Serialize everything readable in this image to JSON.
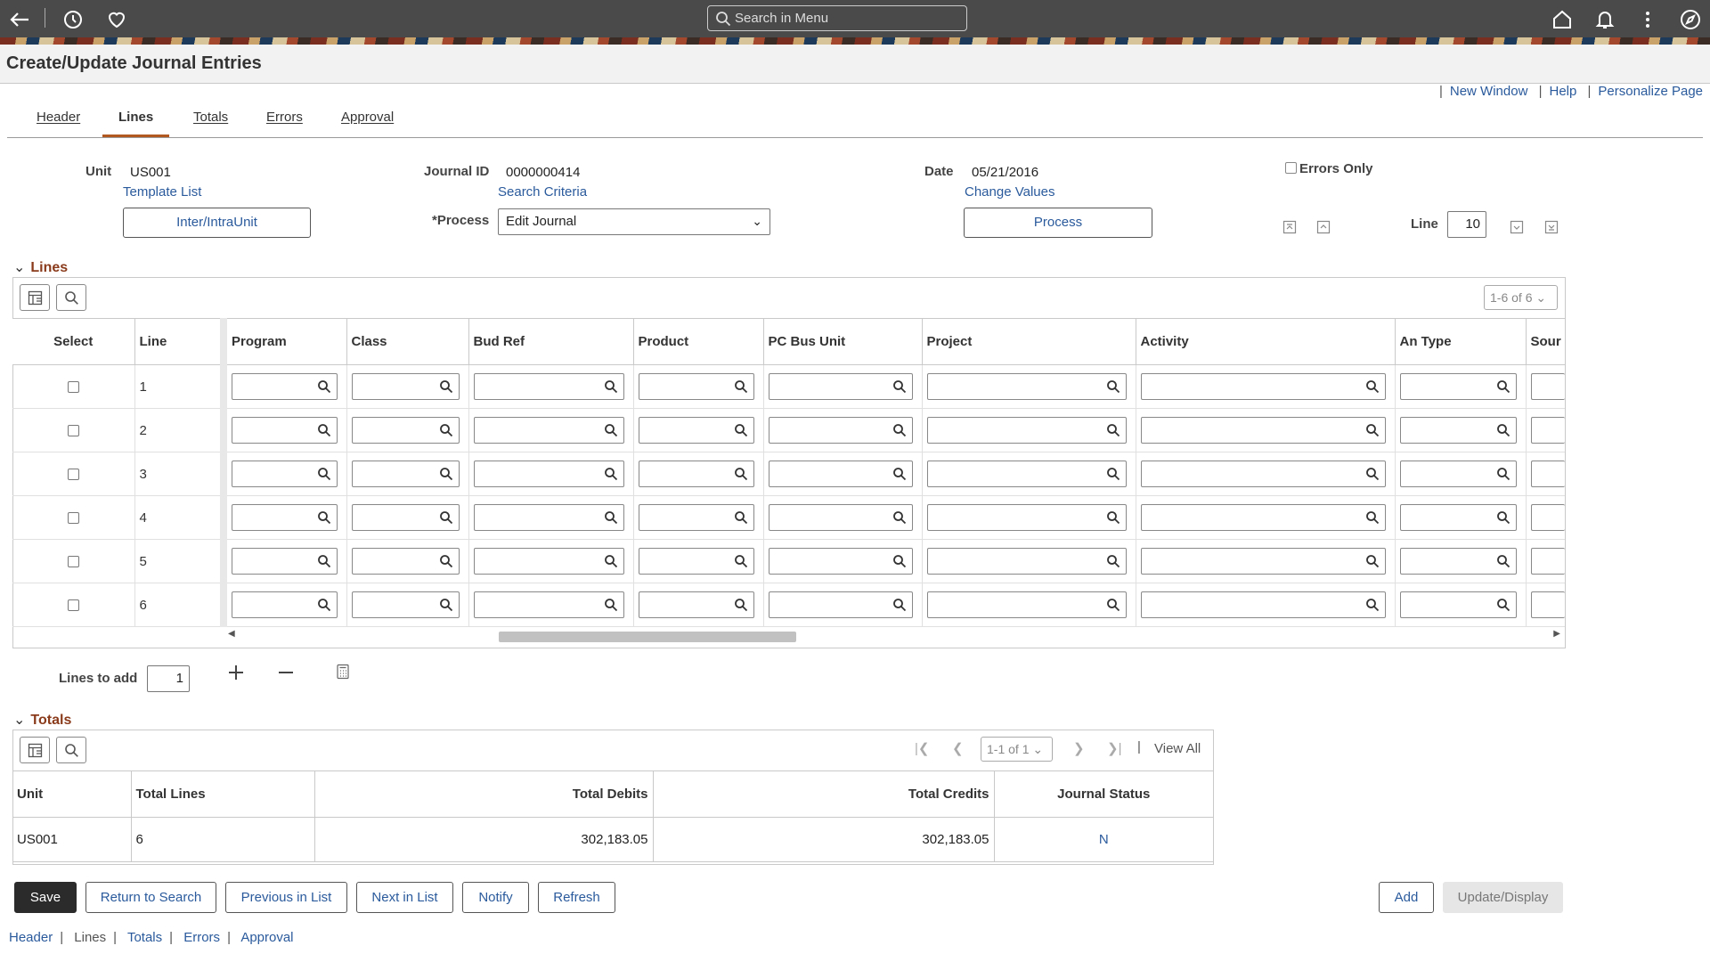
{
  "topbar": {
    "search_placeholder": "Search in Menu"
  },
  "page": {
    "title": "Create/Update Journal Entries"
  },
  "toplinks": [
    "New Window",
    "Help",
    "Personalize Page"
  ],
  "tabs": [
    "Header",
    "Lines",
    "Totals",
    "Errors",
    "Approval"
  ],
  "active_tab": "Lines",
  "header": {
    "unit_label": "Unit",
    "unit_value": "US001",
    "template_list": "Template List",
    "interunit_btn": "Inter/IntraUnit",
    "journal_id_label": "Journal ID",
    "journal_id_value": "0000000414",
    "search_criteria": "Search Criteria",
    "process_label": "*Process",
    "process_value": "Edit Journal",
    "date_label": "Date",
    "date_value": "05/21/2016",
    "change_values": "Change Values",
    "process_btn": "Process",
    "errors_only_label": "Errors Only",
    "line_label": "Line",
    "line_value": "10"
  },
  "lines_section": {
    "title": "Lines",
    "pager": "1-6 of 6",
    "columns": [
      "Select",
      "Line",
      "Program",
      "Class",
      "Bud Ref",
      "Product",
      "PC Bus Unit",
      "Project",
      "Activity",
      "An Type",
      "Sour"
    ],
    "rows": [
      {
        "line": "1"
      },
      {
        "line": "2"
      },
      {
        "line": "3"
      },
      {
        "line": "4"
      },
      {
        "line": "5"
      },
      {
        "line": "6"
      }
    ],
    "lines_to_add_label": "Lines to add",
    "lines_to_add_value": "1"
  },
  "totals_section": {
    "title": "Totals",
    "pager": "1-1 of 1",
    "view_all": "View All",
    "columns": [
      "Unit",
      "Total Lines",
      "Total Debits",
      "Total Credits",
      "Journal Status"
    ],
    "row": {
      "unit": "US001",
      "total_lines": "6",
      "total_debits": "302,183.05",
      "total_credits": "302,183.05",
      "journal_status": "N"
    }
  },
  "buttons": {
    "save": "Save",
    "return_to_search": "Return to Search",
    "previous_in_list": "Previous in List",
    "next_in_list": "Next in List",
    "notify": "Notify",
    "refresh": "Refresh",
    "add": "Add",
    "update_display": "Update/Display"
  },
  "footer_links": [
    "Header",
    "Lines",
    "Totals",
    "Errors",
    "Approval"
  ]
}
